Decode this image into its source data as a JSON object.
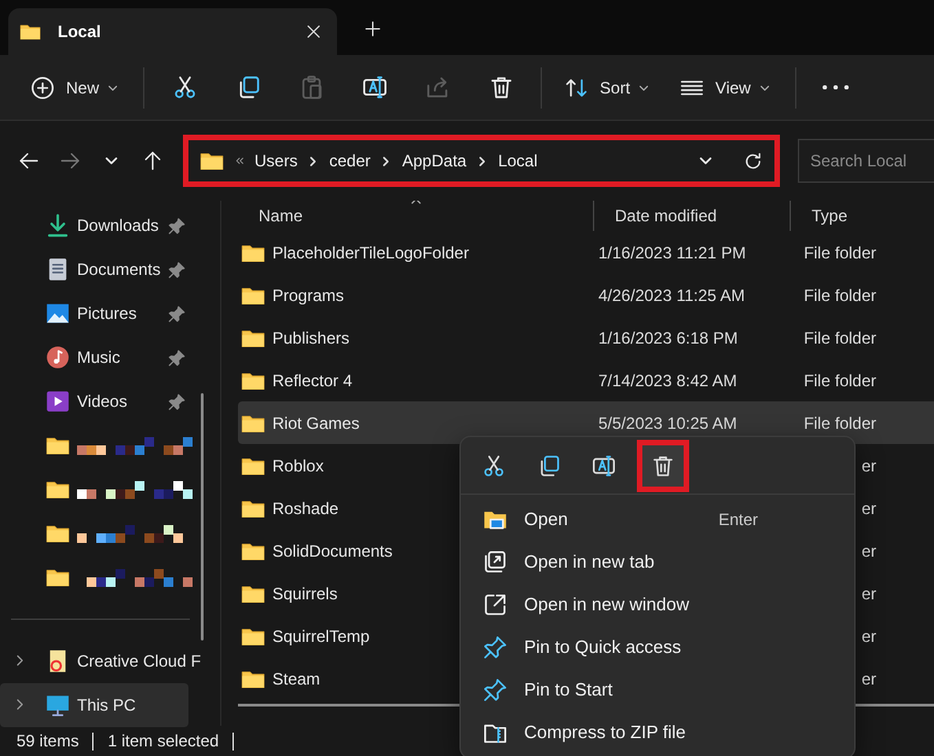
{
  "tabs": [
    {
      "title": "Local",
      "selected": true
    }
  ],
  "toolbar": {
    "items": [
      {
        "kind": "new",
        "label": "New",
        "disabled": false
      },
      {
        "kind": "separator"
      },
      {
        "kind": "cut",
        "disabled": false
      },
      {
        "kind": "copy",
        "disabled": false
      },
      {
        "kind": "paste",
        "disabled": true
      },
      {
        "kind": "rename",
        "disabled": false
      },
      {
        "kind": "share",
        "disabled": true
      },
      {
        "kind": "delete",
        "disabled": false
      },
      {
        "kind": "separator"
      },
      {
        "kind": "sort",
        "label": "Sort",
        "disabled": false
      },
      {
        "kind": "view",
        "label": "View",
        "disabled": false
      },
      {
        "kind": "separator"
      },
      {
        "kind": "more",
        "disabled": false
      }
    ]
  },
  "navigation": [
    {
      "kind": "back",
      "disabled": false
    },
    {
      "kind": "forward",
      "disabled": true
    },
    {
      "kind": "recent",
      "disabled": false
    },
    {
      "kind": "up",
      "disabled": false
    }
  ],
  "address_bar": {
    "segments": [
      "Users",
      "ceder",
      "AppData",
      "Local"
    ],
    "annotated": true
  },
  "search": {
    "placeholder": "Search Local"
  },
  "sidebar": {
    "items": [
      {
        "kind": "downloads",
        "label": "Downloads",
        "pinned": true,
        "selected": false
      },
      {
        "kind": "documents",
        "label": "Documents",
        "pinned": true,
        "selected": false
      },
      {
        "kind": "pictures",
        "label": "Pictures",
        "pinned": true,
        "selected": false
      },
      {
        "kind": "music",
        "label": "Music",
        "pinned": true,
        "selected": false
      },
      {
        "kind": "videos",
        "label": "Videos",
        "pinned": true,
        "selected": false
      },
      {
        "kind": "redacted",
        "selected": false
      },
      {
        "kind": "redacted",
        "selected": false
      },
      {
        "kind": "redacted",
        "selected": false
      },
      {
        "kind": "redacted",
        "selected": false
      },
      {
        "kind": "divider"
      },
      {
        "kind": "cloud",
        "label": "Creative Cloud F",
        "selected": false
      },
      {
        "kind": "pc",
        "label": "This PC",
        "selected": true
      }
    ]
  },
  "file_list": {
    "columns": [
      {
        "label": "Name",
        "sorted": true
      },
      {
        "label": "Date modified",
        "sorted": false
      },
      {
        "label": "Type",
        "sorted": false
      }
    ],
    "rows": [
      {
        "name": "PlaceholderTileLogoFolder",
        "date": "1/16/2023 11:21 PM",
        "type": "File folder",
        "selected": false
      },
      {
        "name": "Programs",
        "date": "4/26/2023 11:25 AM",
        "type": "File folder",
        "selected": false
      },
      {
        "name": "Publishers",
        "date": "1/16/2023 6:18 PM",
        "type": "File folder",
        "selected": false
      },
      {
        "name": "Reflector 4",
        "date": "7/14/2023 8:42 AM",
        "type": "File folder",
        "selected": false
      },
      {
        "name": "Riot Games",
        "date": "5/5/2023 10:25 AM",
        "type": "File folder",
        "selected": true
      },
      {
        "name": "Roblox",
        "type": "er",
        "selected": false
      },
      {
        "name": "Roshade",
        "type": "er",
        "selected": false
      },
      {
        "name": "SolidDocuments",
        "type": "er",
        "selected": false
      },
      {
        "name": "Squirrels",
        "type": "er",
        "selected": false
      },
      {
        "name": "SquirrelTemp",
        "type": "er",
        "selected": false
      },
      {
        "name": "Steam",
        "type": "er",
        "selected": false
      }
    ]
  },
  "status_bar": [
    "59 items",
    "1 item selected"
  ],
  "context_menu": {
    "actions": [
      {
        "kind": "cut",
        "annotated": false
      },
      {
        "kind": "copy",
        "annotated": false
      },
      {
        "kind": "rename",
        "annotated": false
      },
      {
        "kind": "delete",
        "annotated": true
      }
    ],
    "items": [
      {
        "kind": "open",
        "label": "Open",
        "shortcut": "Enter"
      },
      {
        "kind": "new-tab",
        "label": "Open in new tab"
      },
      {
        "kind": "new-window",
        "label": "Open in new window"
      },
      {
        "kind": "pin",
        "label": "Pin to Quick access"
      },
      {
        "kind": "pin",
        "label": "Pin to Start"
      },
      {
        "kind": "zip",
        "label": "Compress to ZIP file"
      }
    ]
  }
}
